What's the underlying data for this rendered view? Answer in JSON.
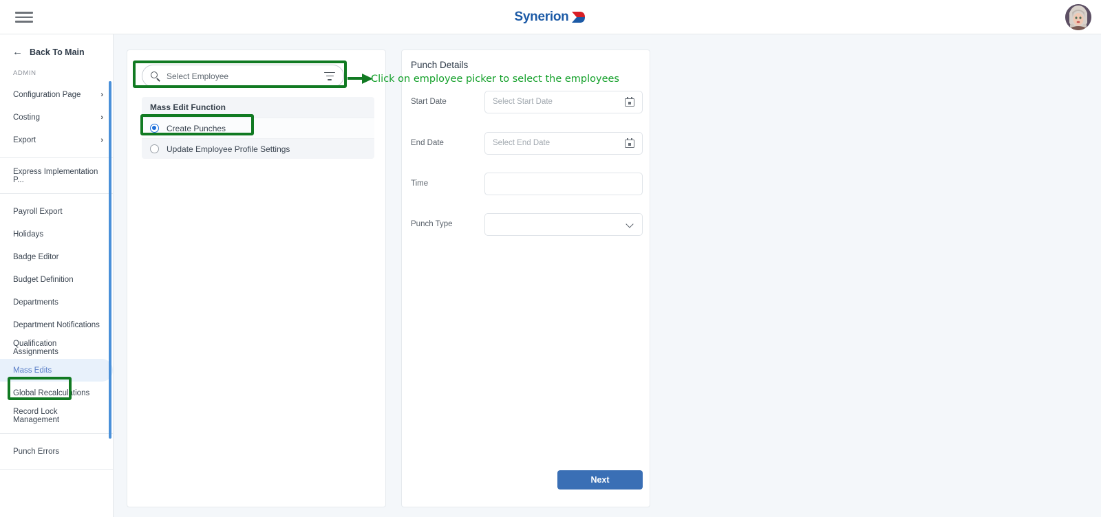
{
  "header": {
    "menu_icon": "hamburger-icon",
    "brand_text": "Synerion",
    "brand_mark": "synerion-arrow-logo",
    "avatar": "user-avatar"
  },
  "sidebar": {
    "back_label": "Back To Main",
    "back_icon": "arrow-left-icon",
    "section_label": "ADMIN",
    "groups": [
      {
        "items": [
          {
            "label": "Configuration Page",
            "chevron": "›",
            "expandable": true
          },
          {
            "label": "Costing",
            "chevron": "›",
            "expandable": true
          },
          {
            "label": "Export",
            "chevron": "›",
            "expandable": true
          }
        ]
      },
      {
        "items": [
          {
            "label": "Express Implementation P...",
            "chevron": "",
            "expandable": false
          }
        ]
      },
      {
        "items": [
          {
            "label": "Payroll Export",
            "chevron": "",
            "expandable": false
          },
          {
            "label": "Holidays",
            "chevron": "",
            "expandable": false
          },
          {
            "label": "Badge Editor",
            "chevron": "",
            "expandable": false
          },
          {
            "label": "Budget Definition",
            "chevron": "",
            "expandable": false
          },
          {
            "label": "Departments",
            "chevron": "",
            "expandable": false
          },
          {
            "label": "Department Notifications",
            "chevron": "",
            "expandable": false
          },
          {
            "label": "Qualification Assignments",
            "chevron": "",
            "expandable": false
          },
          {
            "label": "Mass Edits",
            "chevron": "",
            "expandable": false,
            "active": true
          },
          {
            "label": "Global Recalculations",
            "chevron": "",
            "expandable": false
          },
          {
            "label": "Record Lock Management",
            "chevron": "",
            "expandable": false
          }
        ]
      },
      {
        "items": [
          {
            "label": "Punch Errors",
            "chevron": "",
            "expandable": false
          }
        ]
      }
    ]
  },
  "left_panel": {
    "employee_picker": {
      "placeholder": "Select Employee",
      "value": "",
      "search_icon": "search-icon",
      "filter_icon": "filter-icon"
    },
    "mass_edit_function": {
      "header": "Mass Edit Function",
      "options": [
        {
          "label": "Create Punches",
          "selected": true
        },
        {
          "label": "Update Employee Profile Settings",
          "selected": false
        }
      ]
    }
  },
  "right_panel": {
    "title": "Punch Details",
    "fields": [
      {
        "label": "Start Date",
        "placeholder": "Select Start Date",
        "value": "",
        "icon": "calendar-icon"
      },
      {
        "label": "End Date",
        "placeholder": "Select End Date",
        "value": "",
        "icon": "calendar-icon"
      },
      {
        "label": "Time",
        "placeholder": "",
        "value": "",
        "icon": ""
      },
      {
        "label": "Punch Type",
        "placeholder": "",
        "value": "",
        "icon": "chevron-down-icon"
      }
    ],
    "next_label": "Next"
  },
  "annotations": {
    "instruction_text": "Click on employee picker to select the employees",
    "color": "#14a02a",
    "box_color": "#117a22"
  }
}
